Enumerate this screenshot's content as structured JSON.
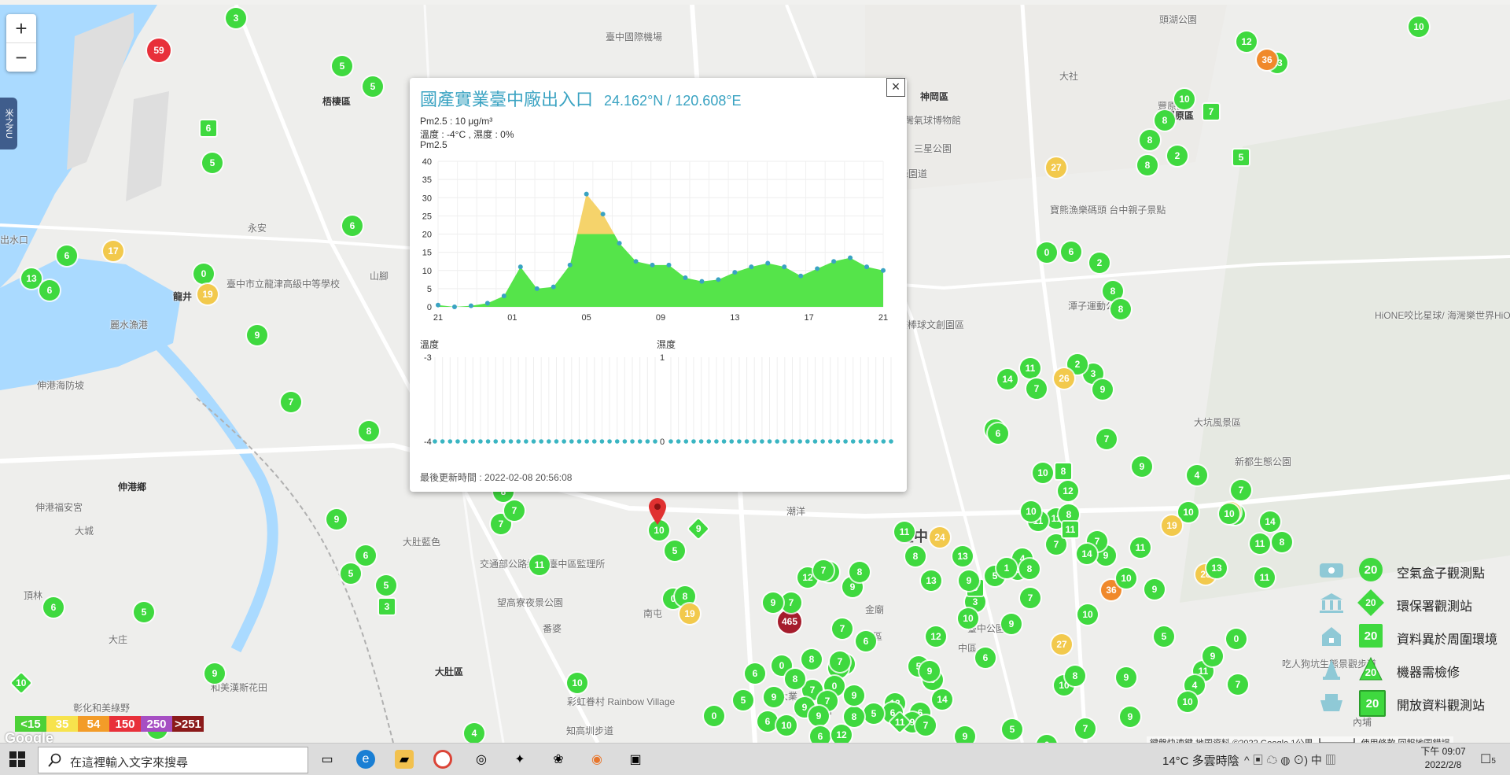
{
  "map": {
    "zoom_in": "+",
    "zoom_out": "−",
    "side_tab": "米之NU",
    "labels": [
      {
        "text": "臺中國際機場",
        "cls": ""
      },
      {
        "text": "梧棲區",
        "cls": "district"
      },
      {
        "text": "神岡區",
        "cls": "district"
      },
      {
        "text": "豐原區",
        "cls": "district"
      },
      {
        "text": "大社",
        "cls": ""
      },
      {
        "text": "台灣氣球博物館",
        "cls": ""
      },
      {
        "text": "三星公園",
        "cls": ""
      },
      {
        "text": "潭雅神綠園道",
        "cls": ""
      },
      {
        "text": "寶熊漁樂碼頭 台中親子景點",
        "cls": ""
      },
      {
        "text": "潭子運動公園",
        "cls": ""
      },
      {
        "text": "洲際棒球文創園區",
        "cls": ""
      },
      {
        "text": "龍井",
        "cls": "district"
      },
      {
        "text": "麗水漁港",
        "cls": ""
      },
      {
        "text": "臺中市立龍津高級中等學校",
        "cls": ""
      },
      {
        "text": "伸港海防坡",
        "cls": ""
      },
      {
        "text": "伸港鄉",
        "cls": "district"
      },
      {
        "text": "伸港福安宮",
        "cls": ""
      },
      {
        "text": "大城",
        "cls": ""
      },
      {
        "text": "頂林",
        "cls": ""
      },
      {
        "text": "大庄",
        "cls": ""
      },
      {
        "text": "大肚區",
        "cls": "district"
      },
      {
        "text": "大肚藍色",
        "cls": ""
      },
      {
        "text": "交通部公路總局 臺中區監理所",
        "cls": ""
      },
      {
        "text": "望高寮夜景公園",
        "cls": ""
      },
      {
        "text": "南屯",
        "cls": ""
      },
      {
        "text": "潮洋",
        "cls": ""
      },
      {
        "text": "臺中",
        "cls": "city"
      },
      {
        "text": "中區",
        "cls": ""
      },
      {
        "text": "臺中公園",
        "cls": ""
      },
      {
        "text": "大坑風景區",
        "cls": ""
      },
      {
        "text": "新都生態公園",
        "cls": ""
      },
      {
        "text": "HiONE咬比星球/ 海灣樂世界HiONE",
        "cls": ""
      },
      {
        "text": "彰化和美綠野",
        "cls": ""
      },
      {
        "text": "和美漢斯花田",
        "cls": ""
      },
      {
        "text": "知高圳步道",
        "cls": ""
      },
      {
        "text": "彩虹眷村 Rainbow Village",
        "cls": ""
      },
      {
        "text": "東區",
        "cls": ""
      },
      {
        "text": "內埔",
        "cls": ""
      },
      {
        "text": "吃人狗坑生態景觀步道",
        "cls": ""
      },
      {
        "text": "頭湖公園",
        "cls": ""
      },
      {
        "text": "豐原區",
        "cls": ""
      },
      {
        "text": "永安",
        "cls": ""
      },
      {
        "text": "出水口",
        "cls": ""
      },
      {
        "text": "山腳",
        "cls": ""
      },
      {
        "text": "豐樂公園",
        "cls": ""
      },
      {
        "text": "大業",
        "cls": ""
      },
      {
        "text": "番婆",
        "cls": ""
      },
      {
        "text": "金廟",
        "cls": ""
      }
    ],
    "markers": [
      {
        "v": "59",
        "c": "#e8303a",
        "t": "big"
      },
      {
        "v": "3",
        "c": "#3fd93f",
        "t": "c"
      },
      {
        "v": "5",
        "c": "#3fd93f",
        "t": "c"
      },
      {
        "v": "5",
        "c": "#3fd93f",
        "t": "c"
      },
      {
        "v": "6",
        "c": "#3fd93f",
        "t": "sq"
      },
      {
        "v": "5",
        "c": "#3fd93f",
        "t": "c"
      },
      {
        "v": "6",
        "c": "#3fd93f",
        "t": "c"
      },
      {
        "v": "17",
        "c": "#f2c94c",
        "t": "c"
      },
      {
        "v": "0",
        "c": "#3fd93f",
        "t": "c"
      },
      {
        "v": "19",
        "c": "#f2c94c",
        "t": "c"
      },
      {
        "v": "13",
        "c": "#3fd93f",
        "t": "c"
      },
      {
        "v": "6",
        "c": "#3fd93f",
        "t": "c"
      },
      {
        "v": "6",
        "c": "#3fd93f",
        "t": "c"
      },
      {
        "v": "9",
        "c": "#3fd93f",
        "t": "c"
      },
      {
        "v": "7",
        "c": "#3fd93f",
        "t": "c"
      },
      {
        "v": "8",
        "c": "#3fd93f",
        "t": "c"
      },
      {
        "v": "9",
        "c": "#3fd93f",
        "t": "c"
      },
      {
        "v": "6",
        "c": "#3fd93f",
        "t": "c"
      },
      {
        "v": "5",
        "c": "#3fd93f",
        "t": "c"
      },
      {
        "v": "5",
        "c": "#3fd93f",
        "t": "c"
      },
      {
        "v": "3",
        "c": "#3fd93f",
        "t": "sq"
      },
      {
        "v": "6",
        "c": "#3fd93f",
        "t": "c"
      },
      {
        "v": "5",
        "c": "#3fd93f",
        "t": "c"
      },
      {
        "v": "9",
        "c": "#3fd93f",
        "t": "c"
      },
      {
        "v": "10",
        "c": "#3fd93f",
        "t": "dm"
      },
      {
        "v": "9",
        "c": "#3fd93f",
        "t": "c"
      },
      {
        "v": "4",
        "c": "#3fd93f",
        "t": "c"
      },
      {
        "v": "10",
        "c": "#3fd93f",
        "t": "c"
      },
      {
        "v": "7",
        "c": "#3fd93f",
        "t": "c"
      },
      {
        "v": "7",
        "c": "#3fd93f",
        "t": "c"
      },
      {
        "v": "8",
        "c": "#3fd93f",
        "t": "c"
      },
      {
        "v": "11",
        "c": "#3fd93f",
        "t": "c"
      },
      {
        "v": "10",
        "c": "#3fd93f",
        "t": "c"
      },
      {
        "v": "9",
        "c": "#3fd93f",
        "t": "dm"
      },
      {
        "v": "5",
        "c": "#3fd93f",
        "t": "c"
      },
      {
        "v": "0",
        "c": "#3fd93f",
        "t": "c"
      },
      {
        "v": "8",
        "c": "#3fd93f",
        "t": "c"
      },
      {
        "v": "19",
        "c": "#f2c94c",
        "t": "c"
      },
      {
        "v": "465",
        "c": "#a51c2c",
        "t": "big"
      },
      {
        "v": "0",
        "c": "#3fd93f",
        "t": "c"
      },
      {
        "v": "6",
        "c": "#3fd93f",
        "t": "c"
      },
      {
        "v": "9",
        "c": "#3fd93f",
        "t": "c"
      },
      {
        "v": "7",
        "c": "#3fd93f",
        "t": "c"
      },
      {
        "v": "12",
        "c": "#3fd93f",
        "t": "c"
      },
      {
        "v": "8",
        "c": "#3fd93f",
        "t": "c"
      },
      {
        "v": "7",
        "c": "#3fd93f",
        "t": "c"
      },
      {
        "v": "8",
        "c": "#3fd93f",
        "t": "c"
      },
      {
        "v": "9",
        "c": "#3fd93f",
        "t": "c"
      },
      {
        "v": "4",
        "c": "#3fd93f",
        "t": "c"
      },
      {
        "v": "7",
        "c": "#3fd93f",
        "t": "c"
      },
      {
        "v": "8",
        "c": "#3fd93f",
        "t": "c"
      },
      {
        "v": "3",
        "c": "#3fd93f",
        "t": "c"
      },
      {
        "v": "7",
        "c": "#3fd93f",
        "t": "c"
      },
      {
        "v": "0",
        "c": "#3fd93f",
        "t": "c"
      },
      {
        "v": "7",
        "c": "#3fd93f",
        "t": "c"
      },
      {
        "v": "9",
        "c": "#3fd93f",
        "t": "c"
      },
      {
        "v": "0",
        "c": "#3fd93f",
        "t": "c"
      },
      {
        "v": "8",
        "c": "#3fd93f",
        "t": "c"
      },
      {
        "v": "9",
        "c": "#3fd93f",
        "t": "c"
      },
      {
        "v": "9",
        "c": "#3fd93f",
        "t": "c"
      },
      {
        "v": "7",
        "c": "#3fd93f",
        "t": "c"
      },
      {
        "v": "6",
        "c": "#3fd93f",
        "t": "c"
      },
      {
        "v": "5",
        "c": "#3fd93f",
        "t": "sq"
      },
      {
        "v": "8",
        "c": "#3fd93f",
        "t": "c"
      },
      {
        "v": "2",
        "c": "#3fd93f",
        "t": "c"
      },
      {
        "v": "27",
        "c": "#f2c94c",
        "t": "c"
      },
      {
        "v": "8",
        "c": "#3fd93f",
        "t": "c"
      },
      {
        "v": "8",
        "c": "#3fd93f",
        "t": "c"
      },
      {
        "v": "10",
        "c": "#3fd93f",
        "t": "c"
      },
      {
        "v": "7",
        "c": "#3fd93f",
        "t": "sq"
      },
      {
        "v": "12",
        "c": "#3fd93f",
        "t": "c"
      },
      {
        "v": "13",
        "c": "#3fd93f",
        "t": "c"
      },
      {
        "v": "10",
        "c": "#3fd93f",
        "t": "c"
      },
      {
        "v": "36",
        "c": "#f0892b",
        "t": "c"
      },
      {
        "v": "0",
        "c": "#3fd93f",
        "t": "c"
      },
      {
        "v": "6",
        "c": "#3fd93f",
        "t": "c"
      },
      {
        "v": "2",
        "c": "#3fd93f",
        "t": "c"
      },
      {
        "v": "8",
        "c": "#3fd93f",
        "t": "c"
      },
      {
        "v": "8",
        "c": "#3fd93f",
        "t": "c"
      },
      {
        "v": "3",
        "c": "#3fd93f",
        "t": "c"
      },
      {
        "v": "2",
        "c": "#3fd93f",
        "t": "c"
      },
      {
        "v": "11",
        "c": "#3fd93f",
        "t": "c"
      },
      {
        "v": "14",
        "c": "#3fd93f",
        "t": "c"
      },
      {
        "v": "7",
        "c": "#3fd93f",
        "t": "c"
      },
      {
        "v": "26",
        "c": "#f2c94c",
        "t": "c"
      },
      {
        "v": "9",
        "c": "#3fd93f",
        "t": "c"
      },
      {
        "v": "7",
        "c": "#3fd93f",
        "t": "c"
      },
      {
        "v": "9",
        "c": "#3fd93f",
        "t": "c"
      },
      {
        "v": "6",
        "c": "#3fd93f",
        "t": "c"
      },
      {
        "v": "9",
        "c": "#3fd93f",
        "t": "c"
      },
      {
        "v": "8",
        "c": "#3fd93f",
        "t": "sq"
      },
      {
        "v": "10",
        "c": "#3fd93f",
        "t": "c"
      },
      {
        "v": "12",
        "c": "#3fd93f",
        "t": "c"
      },
      {
        "v": "11",
        "c": "#3fd93f",
        "t": "c"
      },
      {
        "v": "11",
        "c": "#3fd93f",
        "t": "c"
      },
      {
        "v": "10",
        "c": "#3fd93f",
        "t": "c"
      },
      {
        "v": "5",
        "c": "#3fd93f",
        "t": "c"
      },
      {
        "v": "5",
        "c": "#3fd93f",
        "t": "c"
      },
      {
        "v": "4",
        "c": "#3fd93f",
        "t": "c"
      },
      {
        "v": "3",
        "c": "#3fd93f",
        "t": "c"
      },
      {
        "v": "10",
        "c": "#3fd93f",
        "t": "c"
      },
      {
        "v": "12",
        "c": "#3fd93f",
        "t": "c"
      },
      {
        "v": "6",
        "c": "#3fd93f",
        "t": "c"
      },
      {
        "v": "5",
        "c": "#3fd93f",
        "t": "c"
      },
      {
        "v": "6",
        "c": "#3fd93f",
        "t": "c"
      },
      {
        "v": "14",
        "c": "#3fd93f",
        "t": "c"
      },
      {
        "v": "12",
        "c": "#3fd93f",
        "t": "c"
      },
      {
        "v": "9",
        "c": "#3fd93f",
        "t": "c"
      },
      {
        "v": "6",
        "c": "#3fd93f",
        "t": "c"
      },
      {
        "v": "9",
        "c": "#3fd93f",
        "t": "c"
      },
      {
        "v": "5",
        "c": "#3fd93f",
        "t": "sq"
      },
      {
        "v": "13",
        "c": "#3fd93f",
        "t": "c"
      },
      {
        "v": "24",
        "c": "#f2c94c",
        "t": "c"
      },
      {
        "v": "11",
        "c": "#3fd93f",
        "t": "c"
      },
      {
        "v": "9",
        "c": "#3fd93f",
        "t": "c"
      },
      {
        "v": "8",
        "c": "#3fd93f",
        "t": "c"
      },
      {
        "v": "13",
        "c": "#3fd93f",
        "t": "c"
      },
      {
        "v": "1",
        "c": "#3fd93f",
        "t": "c"
      },
      {
        "v": "8",
        "c": "#3fd93f",
        "t": "c"
      },
      {
        "v": "7",
        "c": "#3fd93f",
        "t": "c"
      },
      {
        "v": "11",
        "c": "#3fd93f",
        "t": "sq"
      },
      {
        "v": "9",
        "c": "#3fd93f",
        "t": "c"
      },
      {
        "v": "8",
        "c": "#3fd93f",
        "t": "c"
      },
      {
        "v": "36",
        "c": "#f0892b",
        "t": "c"
      },
      {
        "v": "7",
        "c": "#3fd93f",
        "t": "c"
      },
      {
        "v": "10",
        "c": "#3fd93f",
        "t": "c"
      },
      {
        "v": "27",
        "c": "#f2c94c",
        "t": "c"
      },
      {
        "v": "10",
        "c": "#3fd93f",
        "t": "c"
      },
      {
        "v": "8",
        "c": "#3fd93f",
        "t": "c"
      },
      {
        "v": "9",
        "c": "#3fd93f",
        "t": "c"
      },
      {
        "v": "5",
        "c": "#3fd93f",
        "t": "c"
      },
      {
        "v": "28",
        "c": "#f2c94c",
        "t": "c"
      },
      {
        "v": "11",
        "c": "#3fd93f",
        "t": "c"
      },
      {
        "v": "8",
        "c": "#3fd93f",
        "t": "c"
      },
      {
        "v": "11",
        "c": "#3fd93f",
        "t": "c"
      },
      {
        "v": "14",
        "c": "#3fd93f",
        "t": "c"
      },
      {
        "v": "13",
        "c": "#3fd93f",
        "t": "c"
      },
      {
        "v": "10",
        "c": "#3fd93f",
        "t": "c"
      },
      {
        "v": "9",
        "c": "#3fd93f",
        "t": "c"
      },
      {
        "v": "7",
        "c": "#3fd93f",
        "t": "c"
      },
      {
        "v": "11",
        "c": "#3fd93f",
        "t": "c"
      },
      {
        "v": "14",
        "c": "#3fd93f",
        "t": "c"
      },
      {
        "v": "10",
        "c": "#3fd93f",
        "t": "c"
      },
      {
        "v": "4",
        "c": "#3fd93f",
        "t": "c"
      },
      {
        "v": "11",
        "c": "#3fd93f",
        "t": "c"
      },
      {
        "v": "7",
        "c": "#3fd93f",
        "t": "c"
      },
      {
        "v": "19",
        "c": "#f2c94c",
        "t": "c"
      },
      {
        "v": "3",
        "c": "#f2c94c",
        "t": "c"
      },
      {
        "v": "10",
        "c": "#3fd93f",
        "t": "c"
      },
      {
        "v": "0",
        "c": "#3fd93f",
        "t": "c"
      },
      {
        "v": "7",
        "c": "#3fd93f",
        "t": "c"
      },
      {
        "v": "11",
        "c": "#3fd93f",
        "t": "c"
      },
      {
        "v": "9",
        "c": "#3fd93f",
        "t": "c"
      },
      {
        "v": "4",
        "c": "#3fd93f",
        "t": "c"
      },
      {
        "v": "10",
        "c": "#3fd93f",
        "t": "c"
      },
      {
        "v": "9",
        "c": "#3fd93f",
        "t": "c"
      },
      {
        "v": "7",
        "c": "#3fd93f",
        "t": "c"
      },
      {
        "v": "6",
        "c": "#3fd93f",
        "t": "c"
      },
      {
        "v": "5",
        "c": "#3fd93f",
        "t": "c"
      },
      {
        "v": "9",
        "c": "#3fd93f",
        "t": "c"
      },
      {
        "v": "9",
        "c": "#3fd93f",
        "t": "c"
      },
      {
        "v": "6",
        "c": "#3fd93f",
        "t": "c"
      },
      {
        "v": "7",
        "c": "#3fd93f",
        "t": "c"
      },
      {
        "v": "11",
        "c": "#3fd93f",
        "t": "dm"
      },
      {
        "v": "5",
        "c": "#3fd93f",
        "t": "c"
      },
      {
        "v": "8",
        "c": "#3fd93f",
        "t": "c"
      },
      {
        "v": "9",
        "c": "#3fd93f",
        "t": "c"
      },
      {
        "v": "10",
        "c": "#3fd93f",
        "t": "c"
      },
      {
        "v": "6",
        "c": "#3fd93f",
        "t": "c"
      },
      {
        "v": "12",
        "c": "#3fd93f",
        "t": "c"
      },
      {
        "v": "5",
        "c": "#3fd93f",
        "t": "c"
      },
      {
        "v": "6",
        "c": "#3fd93f",
        "t": "c"
      }
    ],
    "attribution": "鍵盤快速鍵   地圖資料 ©2022 Google   1公里 ┗━━━┛   使用條款   回報地圖錯誤",
    "google": "Google"
  },
  "popup": {
    "title": "國產實業臺中廠出入口",
    "coords": "24.162°N / 120.608°E",
    "pm_line": "Pm2.5 : 10 μg/m³",
    "temp_line": "溫度 : -4°C , 濕度 : 0%",
    "chart_label": "Pm2.5",
    "temp_label": "溫度",
    "hum_label": "濕度",
    "updated": "最後更新時間 : 2022-02-08 20:56:08",
    "close": "×"
  },
  "chart_data": [
    {
      "type": "area",
      "title": "Pm2.5",
      "x_ticks": [
        "21",
        "01",
        "05",
        "09",
        "13",
        "17",
        "21"
      ],
      "y_ticks": [
        0,
        5,
        10,
        15,
        20,
        25,
        30,
        35,
        40
      ],
      "ylim": [
        0,
        40
      ],
      "values": [
        0.5,
        0,
        0.3,
        1,
        3,
        11,
        5,
        5.5,
        11.5,
        31,
        25.5,
        17.5,
        12.5,
        11.5,
        11.5,
        8,
        7,
        7.5,
        9.5,
        11,
        12,
        11,
        8.5,
        10.5,
        12.5,
        13.5,
        11,
        10
      ],
      "threshold": 20,
      "colors": {
        "below": "#55e44a",
        "above": "#f5d36b",
        "points": "#3aa3c2"
      }
    },
    {
      "type": "line",
      "title": "溫度",
      "y_ticks": [
        -3,
        -4
      ],
      "ylim": [
        -4,
        -3
      ],
      "values": [
        -4
      ],
      "points": 30
    },
    {
      "type": "line",
      "title": "濕度",
      "y_ticks": [
        1,
        0
      ],
      "ylim": [
        0,
        1
      ],
      "values": [
        0
      ],
      "points": 30
    }
  ],
  "scale": [
    {
      "label": "<15",
      "color": "#4cd137"
    },
    {
      "label": "35",
      "color": "#f7e34d"
    },
    {
      "label": "54",
      "color": "#f39c28"
    },
    {
      "label": "150",
      "color": "#e8303a"
    },
    {
      "label": "250",
      "color": "#a64fc3"
    },
    {
      "label": ">251",
      "color": "#8b1a1a"
    }
  ],
  "legend": [
    {
      "icon": "airbox-icon",
      "value": "20",
      "label": "空氣盒子觀測點",
      "shape": "circle"
    },
    {
      "icon": "epa-building-icon",
      "value": "20",
      "label": "環保署觀測站",
      "shape": "diamond"
    },
    {
      "icon": "house-icon",
      "value": "20",
      "label": "資料異於周圍環境",
      "shape": "square"
    },
    {
      "icon": "cone-icon",
      "value": "20",
      "label": "機器需檢修",
      "shape": "triangle"
    },
    {
      "icon": "open-data-icon",
      "value": "20",
      "label": "開放資料觀測站",
      "shape": "square"
    }
  ],
  "taskbar": {
    "search_placeholder": "在這裡輸入文字來搜尋",
    "weather": "14°C 多雲時陰",
    "tray": "^  ▣  ☁  ◍  ⊙)  中  ▥",
    "time": "下午 09:07",
    "date": "2022/2/8",
    "notifications": "5"
  }
}
